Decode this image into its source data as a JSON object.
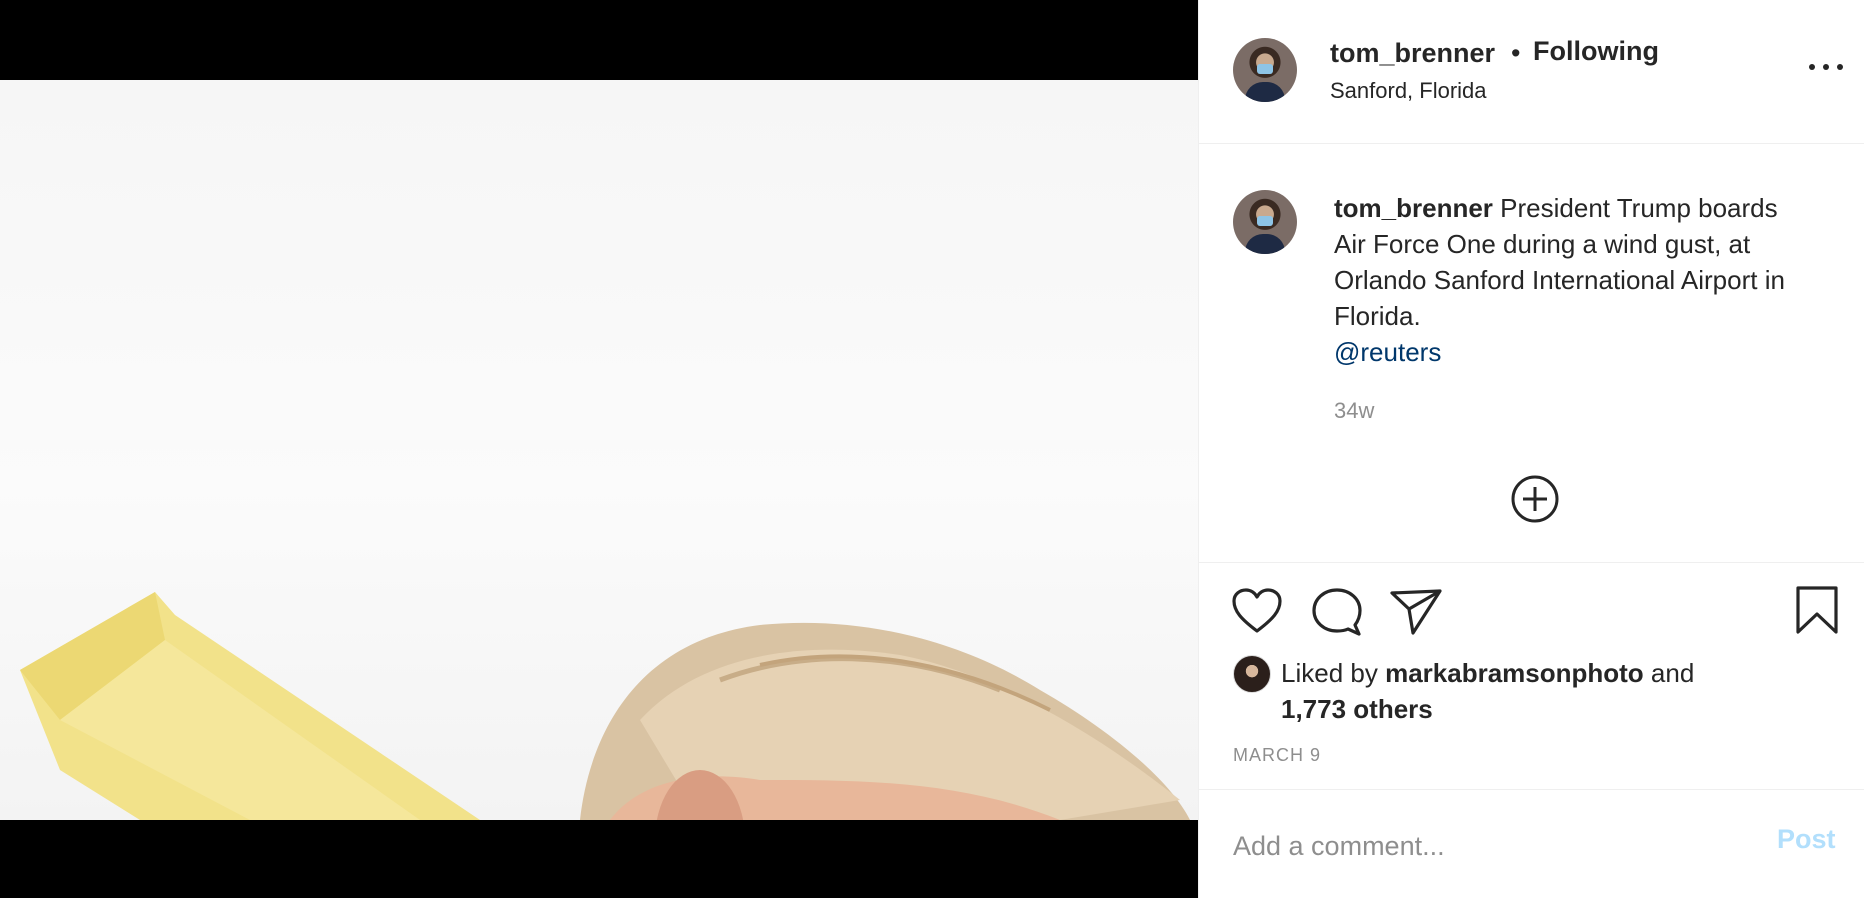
{
  "post": {
    "username": "tom_brenner",
    "follow_status": "Following",
    "separator": "•",
    "location": "Sanford, Florida",
    "caption_text": "President Trump boards Air Force One during a wind gust, at Orlando Sanford International Airport in Florida.",
    "caption_mention": "@reuters",
    "time_ago": "34w",
    "date": "MARCH 9"
  },
  "likes": {
    "prefix": "Liked by",
    "user": "markabramsonphoto",
    "joiner": "and",
    "others": "1,773 others"
  },
  "comment": {
    "placeholder": "Add a comment...",
    "post_label": "Post"
  },
  "icons": {
    "more": "more-options-icon",
    "add": "add-circle-icon",
    "like": "heart-icon",
    "comment": "comment-bubble-icon",
    "share": "paper-plane-icon",
    "save": "bookmark-icon"
  },
  "colors": {
    "text": "#262626",
    "secondary": "#8e8e8e",
    "mention": "#00376b",
    "post_button_disabled": "#b2dffc",
    "divider": "#efefef"
  }
}
